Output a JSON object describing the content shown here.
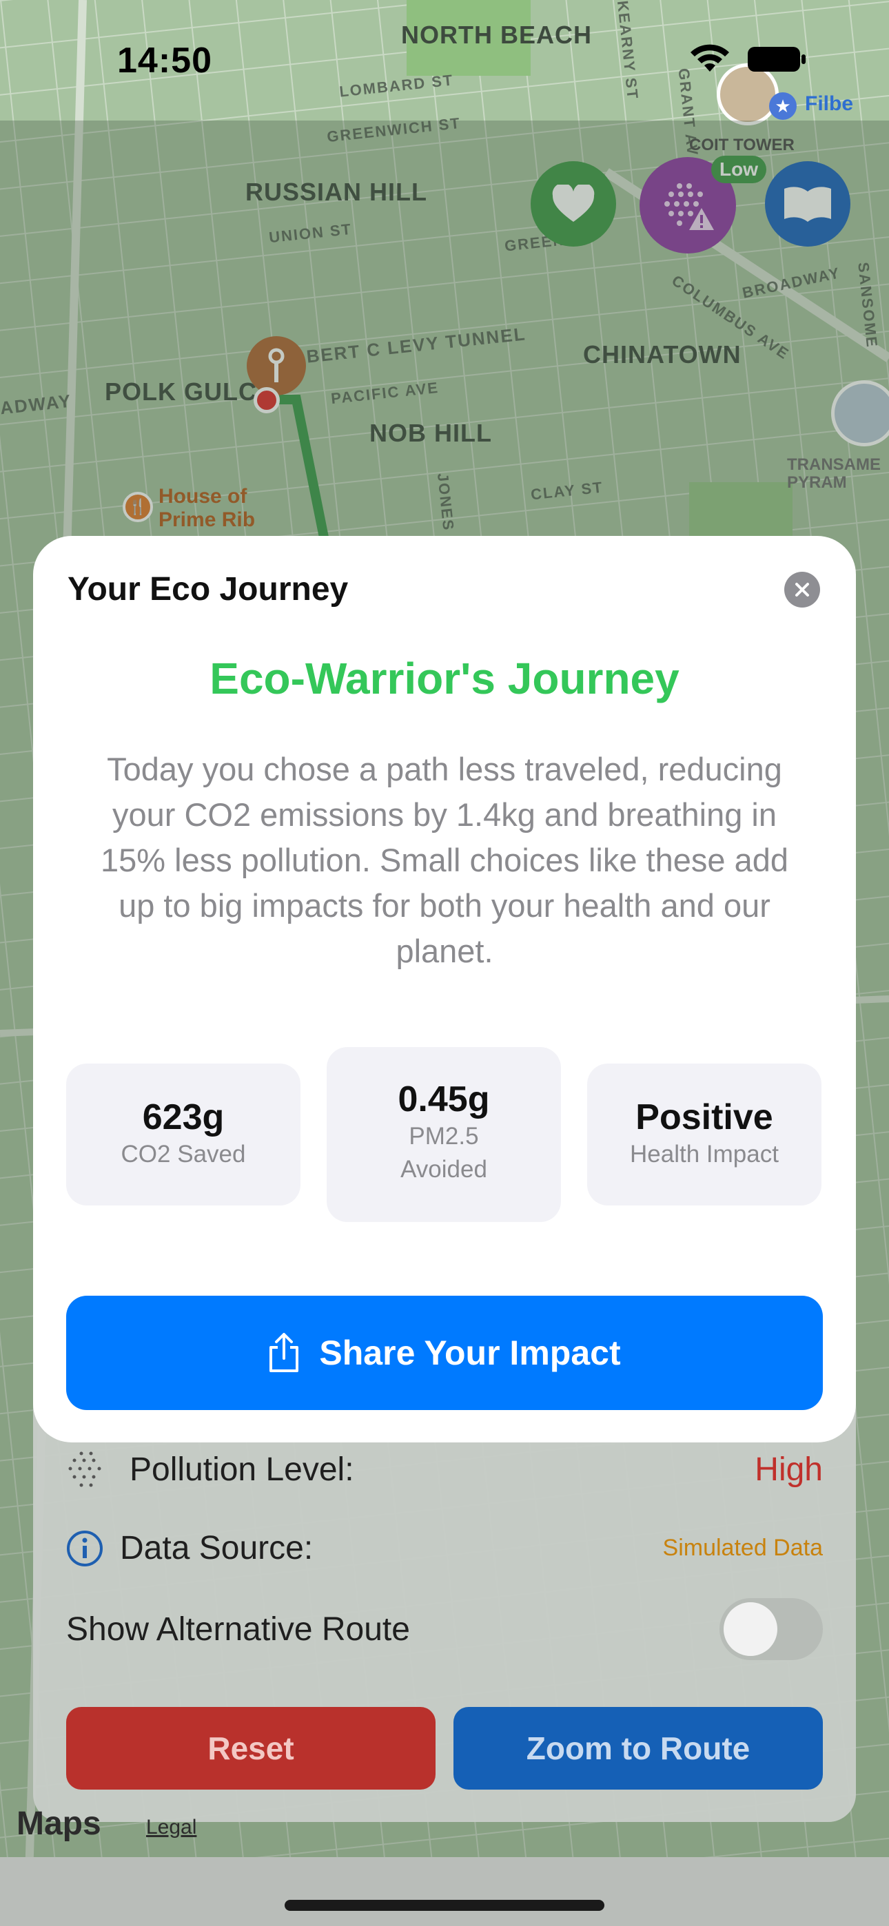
{
  "status_bar": {
    "time": "14:50"
  },
  "map": {
    "neighborhoods": [
      "NORTH BEACH",
      "RUSSIAN HILL",
      "POLK GULCH",
      "NOB HILL",
      "CHINATOWN"
    ],
    "streets": [
      "LOMBARD ST",
      "GREENWICH ST",
      "UNION ST",
      "PACIFIC AVE",
      "CLAY ST",
      "COLUMBUS AVE",
      "BROADWAY",
      "BERT C LEVY TUNNEL",
      "JONES",
      "GREEN",
      "GRANT AV",
      "KEARNY ST",
      "SANSOME",
      "ADWAY"
    ],
    "pois": {
      "coit_tower": "COIT TOWER",
      "house_of_prime_rib": "House of\nPrime Rib",
      "transamerica": "TRANSAME\nPYRAM",
      "filbert": "Filbe"
    },
    "pollution_badge": "Low",
    "attribution_legal": "Legal",
    "attribution_logo": "Maps"
  },
  "panel": {
    "pollution_label": "Pollution Level:",
    "pollution_value": "High",
    "pollution_color": "#d0312d",
    "source_label": "Data Source:",
    "source_value": "Simulated Data",
    "source_color": "#e08a00",
    "alt_route_label": "Show Alternative Route",
    "reset_label": "Reset",
    "zoom_label": "Zoom to Route"
  },
  "modal": {
    "title": "Your Eco Journey",
    "headline": "Eco-Warrior's Journey",
    "story": "Today you chose a path less traveled, reducing your CO2 emissions by 1.4kg and breathing in 15% less pollution. Small choices like these add up to big impacts for both your health and our planet.",
    "stats": [
      {
        "value": "623g",
        "label": "CO2 Saved"
      },
      {
        "value": "0.45g",
        "label": "PM2.5\nAvoided"
      },
      {
        "value": "Positive",
        "label": "Health Impact"
      }
    ],
    "share_label": "Share Your Impact"
  },
  "colors": {
    "accent": "#007aff",
    "headline_green": "#34c759"
  }
}
